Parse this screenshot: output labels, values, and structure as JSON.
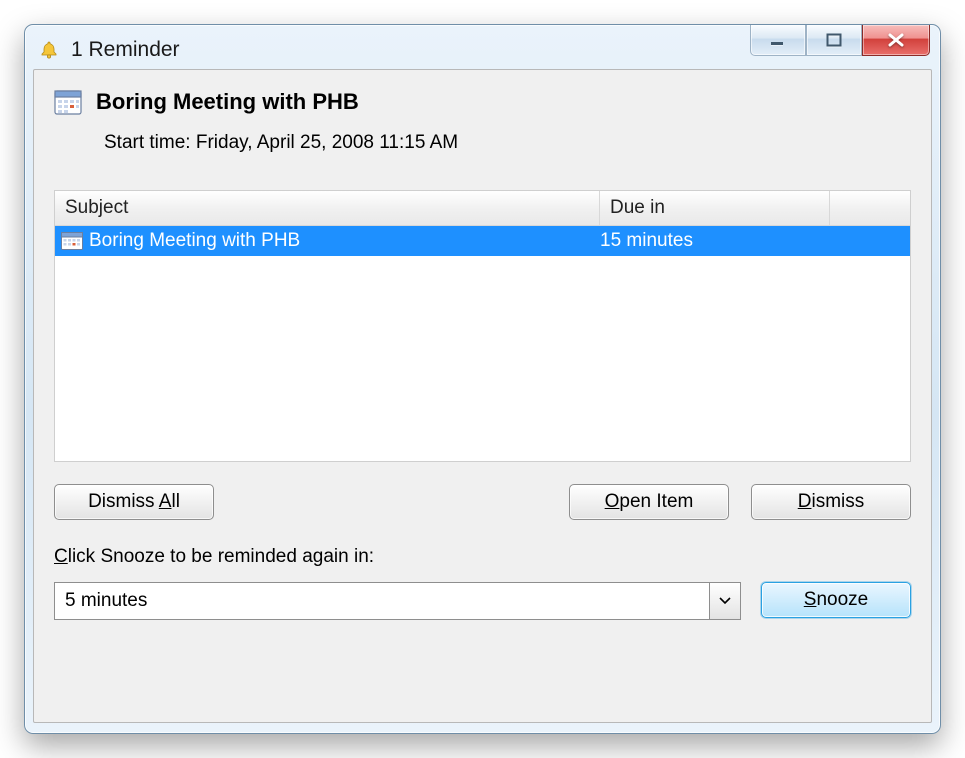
{
  "window": {
    "title": "1 Reminder"
  },
  "reminder": {
    "title": "Boring Meeting with PHB",
    "start_label": "Start time:",
    "start_value": "Friday, April 25, 2008 11:15 AM"
  },
  "list": {
    "columns": {
      "subject": "Subject",
      "due": "Due in"
    },
    "items": [
      {
        "subject": "Boring Meeting with PHB",
        "due": "15 minutes",
        "selected": true
      }
    ]
  },
  "buttons": {
    "dismiss_all_pre": "Dismiss ",
    "dismiss_all_hot": "A",
    "dismiss_all_post": "ll",
    "open_hot": "O",
    "open_post": "pen Item",
    "dismiss_hot": "D",
    "dismiss_post": "ismiss",
    "snooze_hot": "S",
    "snooze_post": "nooze"
  },
  "snooze": {
    "label_hot": "C",
    "label_post": "lick Snooze to be reminded again in:",
    "value": "5 minutes"
  }
}
